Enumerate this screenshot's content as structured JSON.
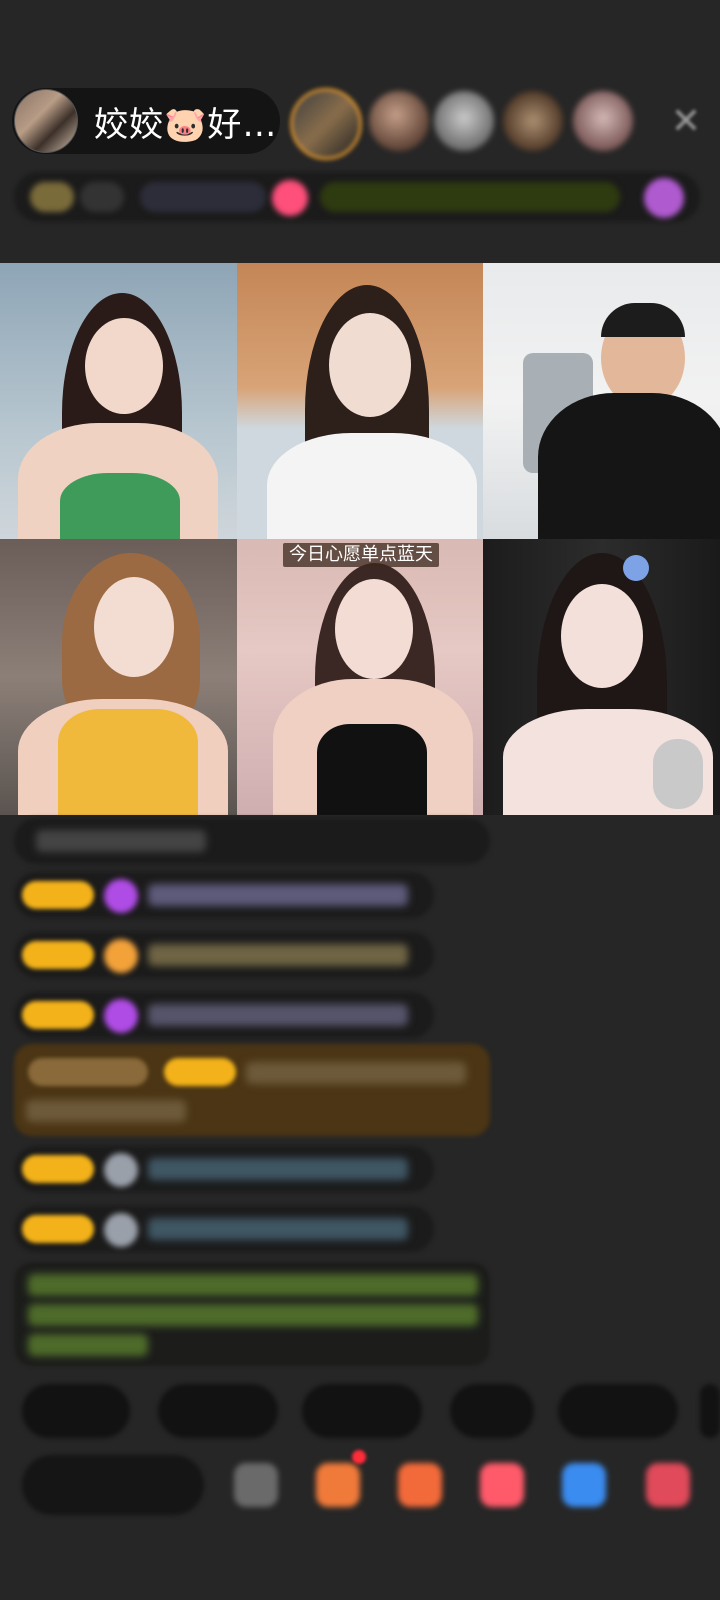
{
  "header": {
    "host_name": "姣姣🐷好…",
    "close_icon": "close-icon",
    "info_chips": [
      "",
      "",
      "",
      "",
      ""
    ]
  },
  "video_grid": {
    "tiles": [
      {
        "position": "top-left",
        "caption": ""
      },
      {
        "position": "top-center",
        "caption": ""
      },
      {
        "position": "top-right",
        "caption": ""
      },
      {
        "position": "bottom-left",
        "caption": ""
      },
      {
        "position": "bottom-center",
        "caption": "今日心愿单点蓝天"
      },
      {
        "position": "bottom-right",
        "caption": ""
      }
    ]
  },
  "chat": {
    "messages_count_visible": 9
  },
  "quick_actions": [
    "",
    "",
    "",
    "",
    ""
  ],
  "input": {
    "placeholder": ""
  },
  "toolbar_icons": [
    "emoji-icon",
    "gift-box-icon",
    "gift-icon",
    "game-icon",
    "message-icon",
    "more-icon"
  ],
  "colors": {
    "background": "#262626",
    "badge": "#f3b21a",
    "brown_highlight": "#4b3514",
    "green_text": "#8fd14f"
  }
}
